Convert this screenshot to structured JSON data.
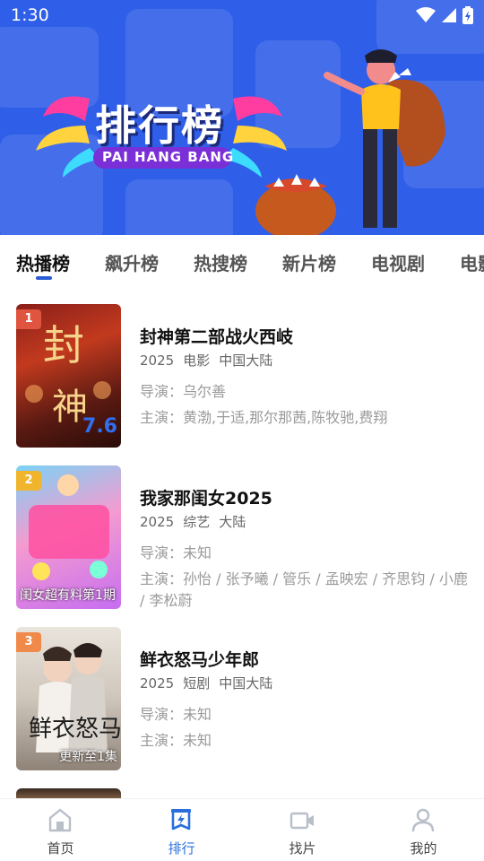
{
  "status_bar": {
    "time": "1:30"
  },
  "banner": {
    "title": "排行榜",
    "subtitle": "PAI HANG BANG",
    "bg_color": "#2f5ee8"
  },
  "tabs": [
    {
      "label": "热播榜",
      "active": true
    },
    {
      "label": "飙升榜",
      "active": false
    },
    {
      "label": "热搜榜",
      "active": false
    },
    {
      "label": "新片榜",
      "active": false
    },
    {
      "label": "电视剧",
      "active": false
    },
    {
      "label": "电影",
      "active": false
    }
  ],
  "list": [
    {
      "rank": "1",
      "rank_color": "#e0553f",
      "poster_caption": "7.6",
      "title": "封神第二部战火西岐",
      "year": "2025",
      "type": "电影",
      "region": "中国大陆",
      "director": "导演：乌尔善",
      "cast": "主演：黄渤,于适,那尔那茜,陈牧驰,费翔"
    },
    {
      "rank": "2",
      "rank_color": "#f0b52c",
      "poster_caption": "闺女超有料第1期",
      "title": "我家那闺女2025",
      "year": "2025",
      "type": "综艺",
      "region": "大陆",
      "director": "导演：未知",
      "cast": "主演：孙怡 / 张予曦 / 管乐 / 孟映宏 / 齐思钧 / 小鹿 / 李松蔚"
    },
    {
      "rank": "3",
      "rank_color": "#f08a4b",
      "poster_caption": "更新至1集",
      "title": "鲜衣怒马少年郎",
      "year": "2025",
      "type": "短剧",
      "region": "中国大陆",
      "director": "导演：未知",
      "cast": "主演：未知"
    }
  ],
  "bottom_nav": [
    {
      "label": "首页",
      "icon": "home-icon",
      "active": false
    },
    {
      "label": "排行",
      "icon": "ranking-icon",
      "active": true
    },
    {
      "label": "找片",
      "icon": "video-camera-icon",
      "active": false
    },
    {
      "label": "我的",
      "icon": "user-icon",
      "active": false
    }
  ],
  "colors": {
    "accent": "#2a6fdb",
    "active_underline": "#2a5bd7"
  }
}
